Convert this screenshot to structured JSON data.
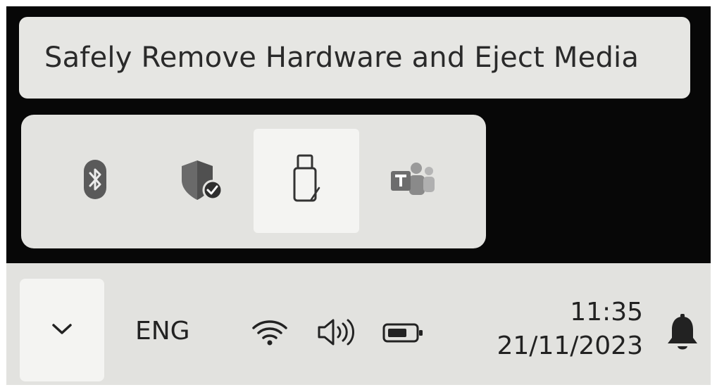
{
  "tooltip": {
    "text": "Safely Remove Hardware and Eject Media"
  },
  "overflow_flyout": {
    "icons": [
      {
        "name": "bluetooth-icon",
        "selected": false
      },
      {
        "name": "windows-security-icon",
        "selected": false
      },
      {
        "name": "usb-drive-eject-icon",
        "selected": true
      },
      {
        "name": "teams-icon",
        "selected": false
      }
    ]
  },
  "taskbar": {
    "overflow_icon": "chevron-down-icon",
    "language": "ENG",
    "tray_icons": [
      "wifi-icon",
      "volume-icon",
      "battery-icon"
    ],
    "time": "11:35",
    "date": "21/11/2023",
    "notification_icon": "bell-icon"
  },
  "colors": {
    "background": "#070707",
    "flyout_bg": "#e3e3e0",
    "selected_bg": "#f4f4f2",
    "taskbar_bg": "#e2e2df",
    "shield_blue": "#2f6fbf",
    "teams_purple": "#5b5fc7"
  }
}
